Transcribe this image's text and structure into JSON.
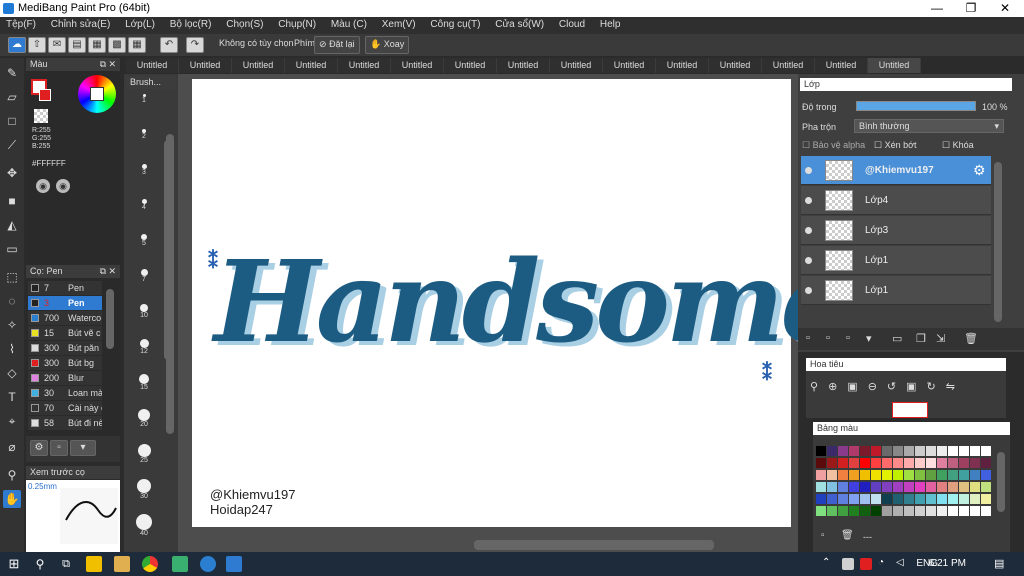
{
  "window": {
    "title": "MediBang Paint Pro (64bit)",
    "min": "—",
    "max": "❐",
    "close": "✕"
  },
  "menu": [
    "Tệp(F)",
    "Chỉnh sửa(E)",
    "Lớp(L)",
    "Bộ lọc(R)",
    "Chọn(S)",
    "Chụp(N)",
    "Màu (C)",
    "Xem(V)",
    "Công cụ(T)",
    "Cửa sổ(W)",
    "Cloud",
    "Help"
  ],
  "toolbar": {
    "snap_label": "Không có tùy chọn",
    "key_label": "Phím",
    "reset_label": "Đặt lại",
    "rotate_label": "Xoay"
  },
  "tabs": [
    "Untitled",
    "Untitled",
    "Untitled",
    "Untitled",
    "Untitled",
    "Untitled",
    "Untitled",
    "Untitled",
    "Untitled",
    "Untitled",
    "Untitled",
    "Untitled",
    "Untitled",
    "Untitled",
    "Untitled"
  ],
  "color_panel": {
    "title": "Màu",
    "r": "R:255",
    "g": "G:255",
    "b": "B:255",
    "hex": "#FFFFFF"
  },
  "brush_panel": {
    "title": "Cọ: Pen",
    "items": [
      {
        "size": "7",
        "name": "Pen",
        "color": "#222222"
      },
      {
        "size": "3",
        "name": "Pen",
        "color": "#222222",
        "selected": true
      },
      {
        "size": "700",
        "name": "Waterco",
        "color": "#2a7fd0"
      },
      {
        "size": "15",
        "name": "Bút vẽ c",
        "color": "#e8e020"
      },
      {
        "size": "300",
        "name": "Bút păn",
        "color": "#dddddd"
      },
      {
        "size": "300",
        "name": "Bút bg",
        "color": "#e02020"
      },
      {
        "size": "200",
        "name": "Blur",
        "color": "#e080e0"
      },
      {
        "size": "30",
        "name": "Loan mà",
        "color": "#40b0e0"
      },
      {
        "size": "70",
        "name": "Cài này c",
        "color": "#333333"
      },
      {
        "size": "58",
        "name": "Bút đi nè",
        "color": "#dddddd"
      }
    ]
  },
  "preview_panel": {
    "title": "Xem trước cọ",
    "size": "0.25mm"
  },
  "brush_strip": {
    "title": "Brush...",
    "sizes": [
      "1",
      "2",
      "3",
      "4",
      "5",
      "7",
      "10",
      "12",
      "15",
      "20",
      "25",
      "30",
      "40"
    ]
  },
  "canvas": {
    "artwork_text": "Handsome",
    "credit_line1": "@Khiemvu197",
    "credit_line2": "Hoidap247"
  },
  "layers_panel": {
    "title": "Lớp",
    "opacity_label": "Độ trong",
    "opacity_value": "100 %",
    "blend_label": "Pha trộn",
    "blend_value": "Bình thường",
    "protect_alpha": "Bảo vệ alpha",
    "clipping": "Xén bớt",
    "lock": "Khóa",
    "layers": [
      {
        "name": "@Khiemvu197",
        "selected": true
      },
      {
        "name": "Lớp4"
      },
      {
        "name": "Lớp3"
      },
      {
        "name": "Lớp1"
      },
      {
        "name": "Lớp1"
      }
    ]
  },
  "navigator": {
    "title": "Hoa tiêu"
  },
  "palette": {
    "title": "Bảng màu",
    "footer": "---",
    "colors": [
      "#000000",
      "#3a2a6a",
      "#8a3a8a",
      "#b03a6a",
      "#7a1a2a",
      "#c01a2a",
      "#6a6a6a",
      "#888888",
      "#aaaaaa",
      "#cccccc",
      "#dddddd",
      "#eeeeee",
      "#ffffff",
      "#ffffff",
      "#ffffff",
      "#ffffff",
      "#5a0a0a",
      "#9a1a1a",
      "#d02020",
      "#e04040",
      "#ff0000",
      "#ff4040",
      "#ff6a6a",
      "#ff8a8a",
      "#ffaaaa",
      "#ffcccc",
      "#ffe0e0",
      "#e080a0",
      "#c06080",
      "#a04060",
      "#803050",
      "#602040",
      "#f0a0a0",
      "#f0c0a0",
      "#f08040",
      "#f0a020",
      "#f0c000",
      "#f0e000",
      "#e0f000",
      "#c0f000",
      "#a0e040",
      "#80c040",
      "#60a040",
      "#40a060",
      "#40a080",
      "#40a0a0",
      "#4080c0",
      "#4060e0",
      "#a0e0e0",
      "#80c0e0",
      "#6080e0",
      "#4040e0",
      "#2020c0",
      "#6040c0",
      "#8040c0",
      "#a040c0",
      "#c040c0",
      "#e040c0",
      "#e060a0",
      "#e08080",
      "#e0a080",
      "#e0c080",
      "#e0e080",
      "#c0e080",
      "#2040c0",
      "#4060d0",
      "#6080e0",
      "#80a0f0",
      "#a0c0f0",
      "#c0e0f0",
      "#104050",
      "#206070",
      "#308090",
      "#40a0b0",
      "#60c0d0",
      "#80e0f0",
      "#a0f0f0",
      "#c0f0e0",
      "#e0f0c0",
      "#f0f0a0",
      "#80e080",
      "#60c060",
      "#40a040",
      "#208020",
      "#106010",
      "#004000",
      "#a0a0a0",
      "#b0b0b0",
      "#c0c0c0",
      "#d0d0d0",
      "#e0e0e0",
      "#f0f0f0",
      "#ffffff",
      "#ffffff",
      "#ffffff",
      "#ffffff"
    ]
  },
  "taskbar": {
    "lang": "ENG",
    "time": "6:21 PM"
  }
}
